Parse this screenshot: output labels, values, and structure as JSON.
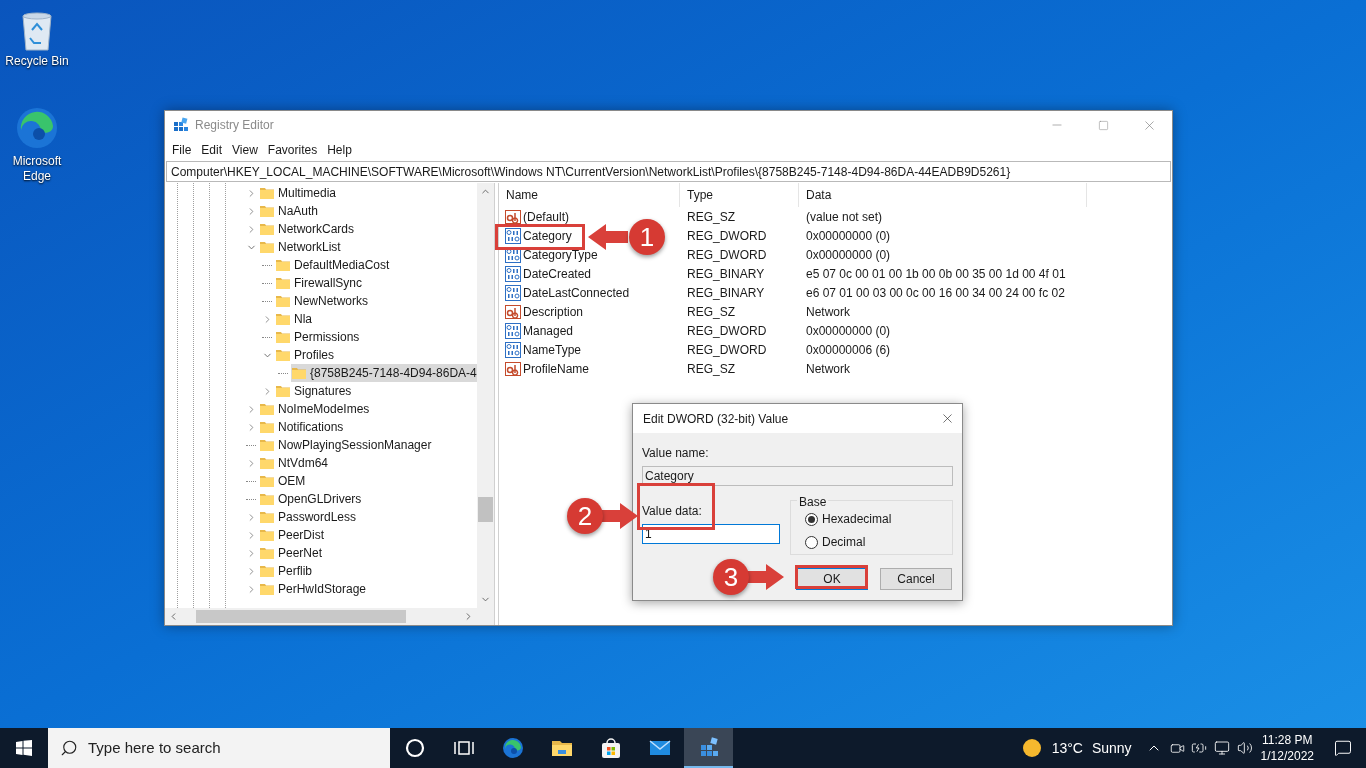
{
  "desktop_icons": [
    {
      "kind": "recycle-bin",
      "label": "Recycle Bin"
    },
    {
      "kind": "edge",
      "label": "Microsoft Edge"
    }
  ],
  "window": {
    "title": "Registry Editor",
    "menu": [
      "File",
      "Edit",
      "View",
      "Favorites",
      "Help"
    ],
    "address": "Computer\\HKEY_LOCAL_MACHINE\\SOFTWARE\\Microsoft\\Windows NT\\CurrentVersion\\NetworkList\\Profiles\\{8758B245-7148-4D94-86DA-44EADB9D5261}",
    "tree": [
      {
        "label": "Multimedia",
        "kind": "branch",
        "expanded": false,
        "selected": false
      },
      {
        "label": "NaAuth",
        "kind": "branch",
        "expanded": false,
        "selected": false
      },
      {
        "label": "NetworkCards",
        "kind": "branch",
        "expanded": false,
        "selected": false
      },
      {
        "label": "NetworkList",
        "kind": "branch",
        "expanded": true,
        "selected": false,
        "children": [
          {
            "label": "DefaultMediaCost",
            "kind": "leaf",
            "selected": false
          },
          {
            "label": "FirewallSync",
            "kind": "leaf",
            "selected": false
          },
          {
            "label": "NewNetworks",
            "kind": "leaf",
            "selected": false
          },
          {
            "label": "Nla",
            "kind": "branch",
            "expanded": false,
            "selected": false
          },
          {
            "label": "Permissions",
            "kind": "leaf",
            "selected": false
          },
          {
            "label": "Profiles",
            "kind": "branch",
            "expanded": true,
            "selected": false,
            "children": [
              {
                "label": "{8758B245-7148-4D94-86DA-4",
                "kind": "leaf",
                "selected": true
              }
            ]
          },
          {
            "label": "Signatures",
            "kind": "branch",
            "expanded": false,
            "selected": false
          }
        ]
      },
      {
        "label": "NoImeModeImes",
        "kind": "branch",
        "expanded": false,
        "selected": false
      },
      {
        "label": "Notifications",
        "kind": "branch",
        "expanded": false,
        "selected": false
      },
      {
        "label": "NowPlayingSessionManager",
        "kind": "leaf",
        "selected": false
      },
      {
        "label": "NtVdm64",
        "kind": "branch",
        "expanded": false,
        "selected": false
      },
      {
        "label": "OEM",
        "kind": "leaf",
        "selected": false
      },
      {
        "label": "OpenGLDrivers",
        "kind": "leaf",
        "selected": false
      },
      {
        "label": "PasswordLess",
        "kind": "branch",
        "expanded": false,
        "selected": false
      },
      {
        "label": "PeerDist",
        "kind": "branch",
        "expanded": false,
        "selected": false
      },
      {
        "label": "PeerNet",
        "kind": "branch",
        "expanded": false,
        "selected": false
      },
      {
        "label": "Perflib",
        "kind": "branch",
        "expanded": false,
        "selected": false
      },
      {
        "label": "PerHwIdStorage",
        "kind": "branch",
        "expanded": false,
        "selected": false
      }
    ],
    "columns": [
      "Name",
      "Type",
      "Data"
    ],
    "values": [
      {
        "kind": "string",
        "name": "(Default)",
        "type": "REG_SZ",
        "data": "(value not set)"
      },
      {
        "kind": "binary",
        "name": "Category",
        "type": "REG_DWORD",
        "data": "0x00000000 (0)"
      },
      {
        "kind": "binary",
        "name": "CategoryType",
        "type": "REG_DWORD",
        "data": "0x00000000 (0)"
      },
      {
        "kind": "binary",
        "name": "DateCreated",
        "type": "REG_BINARY",
        "data": "e5 07 0c 00 01 00 1b 00 0b 00 35 00 1d 00 4f 01"
      },
      {
        "kind": "binary",
        "name": "DateLastConnected",
        "type": "REG_BINARY",
        "data": "e6 07 01 00 03 00 0c 00 16 00 34 00 24 00 fc 02"
      },
      {
        "kind": "string",
        "name": "Description",
        "type": "REG_SZ",
        "data": "Network"
      },
      {
        "kind": "binary",
        "name": "Managed",
        "type": "REG_DWORD",
        "data": "0x00000000 (0)"
      },
      {
        "kind": "binary",
        "name": "NameType",
        "type": "REG_DWORD",
        "data": "0x00000006 (6)"
      },
      {
        "kind": "string",
        "name": "ProfileName",
        "type": "REG_SZ",
        "data": "Network"
      }
    ]
  },
  "dialog": {
    "title": "Edit DWORD (32-bit) Value",
    "value_name_label": "Value name:",
    "value_name": "Category",
    "value_data_label": "Value data:",
    "value_data": "1",
    "base_label": "Base",
    "bases": [
      {
        "label": "Hexadecimal",
        "selected": true
      },
      {
        "label": "Decimal",
        "selected": false
      }
    ],
    "buttons": [
      {
        "label": "OK",
        "default": true
      },
      {
        "label": "Cancel",
        "default": false
      }
    ]
  },
  "annotations": [
    {
      "number": "1"
    },
    {
      "number": "2"
    },
    {
      "number": "3"
    }
  ],
  "taskbar": {
    "search_placeholder": "Type here to search",
    "apps": [
      {
        "kind": "cortana",
        "active": false
      },
      {
        "kind": "task-view",
        "active": false
      },
      {
        "kind": "edge",
        "active": false
      },
      {
        "kind": "explorer",
        "active": false
      },
      {
        "kind": "store",
        "active": false
      },
      {
        "kind": "mail",
        "active": false
      },
      {
        "kind": "regedit",
        "active": true
      }
    ],
    "temperature": "13°C",
    "condition": "Sunny",
    "time": "11:28 PM",
    "date": "1/12/2022"
  }
}
